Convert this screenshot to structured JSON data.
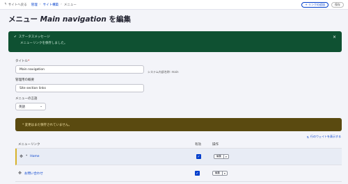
{
  "topbar": {
    "back_label": "サイトへ戻る",
    "breadcrumbs": [
      "管理",
      "サイト構築",
      "メニュー"
    ],
    "add_link_label": "+ リンクの追加",
    "save_label": "保存"
  },
  "page": {
    "title_prefix": "メニュー",
    "title_name": "Main navigation",
    "title_suffix": "を編集"
  },
  "status": {
    "heading": "ステータスメッセージ",
    "message": "メニューリンクを保存しました。"
  },
  "form": {
    "title_label": "タイトル",
    "title_value": "Main navigation",
    "machine_name": "システム内部名称: main",
    "admin_label": "管理用の概要",
    "admin_value": "Site section links",
    "lang_label": "メニューの言語",
    "lang_value": "英語"
  },
  "warning": "* 変更はまだ保存されていません。",
  "show_weights": "行のウェイトを表示する",
  "table": {
    "headers": [
      "メニューリンク",
      "有効",
      "操作"
    ],
    "rows": [
      {
        "label": "Home",
        "changed_mark": "*",
        "edit": "編集"
      },
      {
        "label": "お問い合わせ",
        "changed_mark": "",
        "edit": "編集"
      }
    ]
  }
}
